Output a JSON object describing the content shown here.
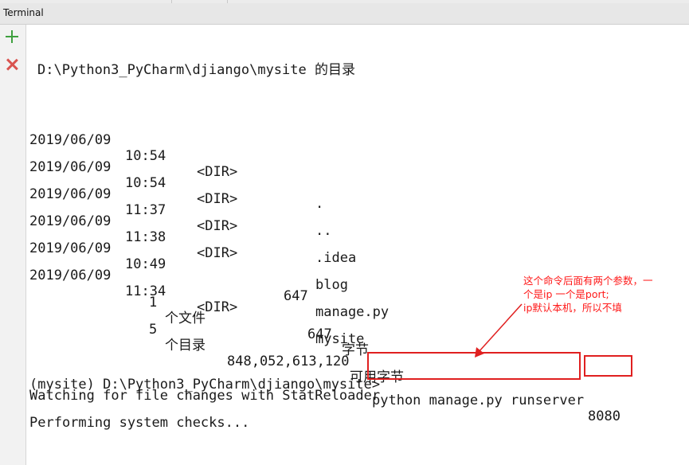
{
  "panel": {
    "title": "Terminal"
  },
  "terminal": {
    "dir_header": "D:\\Python3_PyCharm\\djiango\\mysite 的目录",
    "entries": [
      {
        "date": "2019/06/09",
        "time": "10:54",
        "type": "<DIR>",
        "size": "",
        "name": "."
      },
      {
        "date": "2019/06/09",
        "time": "10:54",
        "type": "<DIR>",
        "size": "",
        "name": ".."
      },
      {
        "date": "2019/06/09",
        "time": "11:37",
        "type": "<DIR>",
        "size": "",
        "name": ".idea"
      },
      {
        "date": "2019/06/09",
        "time": "11:38",
        "type": "<DIR>",
        "size": "",
        "name": "blog"
      },
      {
        "date": "2019/06/09",
        "time": "10:49",
        "type": "",
        "size": "647",
        "name": "manage.py"
      },
      {
        "date": "2019/06/09",
        "time": "11:34",
        "type": "<DIR>",
        "size": "",
        "name": "mysite"
      }
    ],
    "summary_files": {
      "count": "1",
      "label": "个文件",
      "bytes": "647",
      "unit": "字节"
    },
    "summary_dirs": {
      "count": "5",
      "label": "个目录",
      "bytes": "848,052,613,120",
      "unit": "可用字节"
    },
    "prompt": "(mysite) D:\\Python3_PyCharm\\djiango\\mysite>",
    "command": "python manage.py runserver",
    "port": "8080",
    "output": [
      "Watching for file changes with StatReloader",
      "Performing system checks..."
    ]
  },
  "annotation": {
    "lines": [
      "这个命令后面有两个参数，一",
      "个是ip  一个是port;",
      "ip默认本机，所以不填"
    ],
    "color": "#ff1a1a"
  }
}
